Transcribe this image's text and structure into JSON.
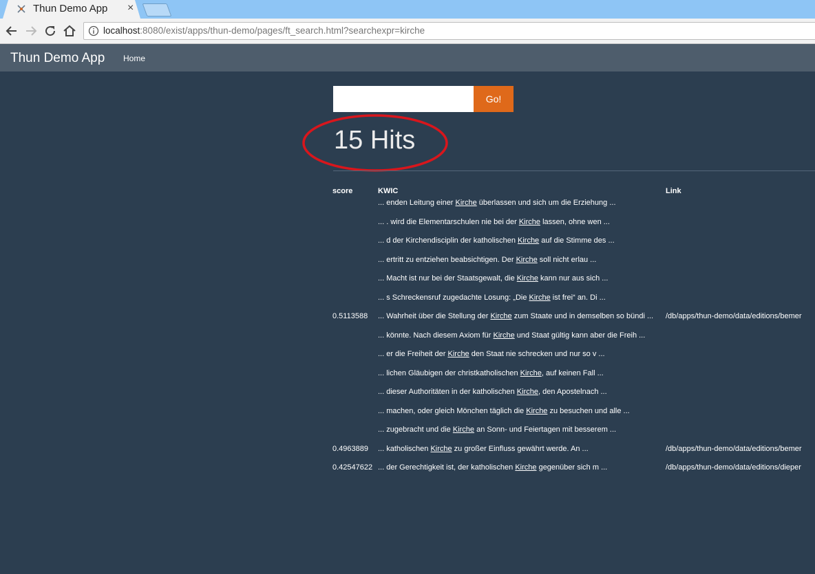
{
  "browser": {
    "tab_title": "Thun Demo App",
    "tab_close": "×",
    "url_host": "localhost",
    "url_rest": ":8080/exist/apps/thun-demo/pages/ft_search.html?searchexpr=kirche"
  },
  "navbar": {
    "brand": "Thun Demo App",
    "home": "Home"
  },
  "search": {
    "value": "",
    "button": "Go!"
  },
  "hits_label": "15 Hits",
  "table": {
    "headers": {
      "score": "score",
      "kwic": "KWIC",
      "link": "Link"
    },
    "results": [
      {
        "score": "0.5113588",
        "link": "/db/apps/thun-demo/data/editions/bemer",
        "kwic": [
          {
            "pre": "... enden Leitung einer ",
            "hit": "Kirche",
            "post": " überlassen und sich um die Erziehung ..."
          },
          {
            "pre": "... . wird die Elementarschulen nie bei der ",
            "hit": "Kirche",
            "post": " lassen, ohne wen ..."
          },
          {
            "pre": "... d der Kirchendisciplin der katholischen ",
            "hit": "Kirche",
            "post": " auf die Stimme des ..."
          },
          {
            "pre": "... ertritt zu entziehen beabsichtigen. Der ",
            "hit": "Kirche",
            "post": " soll nicht erlau ..."
          },
          {
            "pre": "... Macht ist nur bei der Staatsgewalt, die ",
            "hit": "Kirche",
            "post": " kann nur aus sich ..."
          },
          {
            "pre": "... s Schreckensruf zugedachte Losung: „Die ",
            "hit": "Kirche",
            "post": " ist frei“ an. Di ..."
          },
          {
            "pre": "... Wahrheit über die Stellung der ",
            "hit": "Kirche",
            "post": " zum Staate und in demselben so bündi ..."
          },
          {
            "pre": "... könnte. Nach diesem Axiom für ",
            "hit": "Kirche",
            "post": " und Staat gültig kann aber die Freih ..."
          },
          {
            "pre": "... er die Freiheit der ",
            "hit": "Kirche",
            "post": " den Staat nie schrecken und nur so v ..."
          },
          {
            "pre": "... lichen Gläubigen der christkatholischen ",
            "hit": "Kirche",
            "post": ", auf keinen Fall ..."
          },
          {
            "pre": "... dieser Authoritäten in der katholischen ",
            "hit": "Kirche",
            "post": ", den Apostelnach ..."
          },
          {
            "pre": "... machen, oder gleich Mönchen täglich die ",
            "hit": "Kirche",
            "post": " zu besuchen und alle ..."
          },
          {
            "pre": "... zugebracht und die ",
            "hit": "Kirche",
            "post": " an Sonn- und Feiertagen mit besserem ..."
          }
        ]
      },
      {
        "score": "0.4963889",
        "link": "/db/apps/thun-demo/data/editions/bemer",
        "kwic": [
          {
            "pre": "... katholischen ",
            "hit": "Kirche",
            "post": " zu großer Einfluss gewährt werde. An ..."
          }
        ]
      },
      {
        "score": "0.42547622",
        "link": "/db/apps/thun-demo/data/editions/dieper",
        "kwic": [
          {
            "pre": "... der Gerechtigkeit ist, der katholischen ",
            "hit": "Kirche",
            "post": " gegenüber sich m ..."
          }
        ]
      }
    ]
  },
  "colors": {
    "page_bg": "#2c3e50",
    "navbar_bg": "#4e5d6c",
    "accent": "#df691a",
    "annotation_circle": "#d9161c"
  },
  "icons": [
    "tab-favicon-icon",
    "back-icon",
    "forward-icon",
    "reload-icon",
    "home-icon",
    "info-icon"
  ]
}
